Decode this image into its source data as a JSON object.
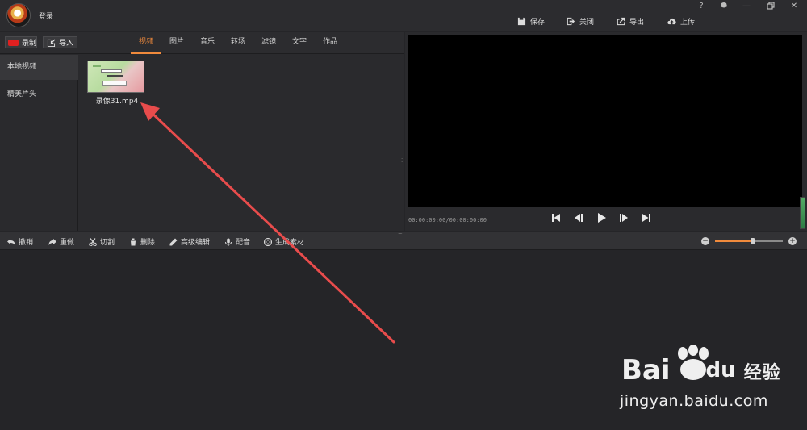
{
  "header": {
    "login_label": "登录",
    "window_controls": {
      "help": "?",
      "skin": "skin-icon",
      "minimize": "—",
      "restore": "restore-icon",
      "close": "✕"
    },
    "actions": {
      "save": "保存",
      "close": "关闭",
      "export": "导出",
      "upload": "上传"
    }
  },
  "media": {
    "record_label": "录制",
    "import_label": "导入",
    "tabs": [
      {
        "label": "视频",
        "active": true
      },
      {
        "label": "图片",
        "active": false
      },
      {
        "label": "音乐",
        "active": false
      },
      {
        "label": "转场",
        "active": false
      },
      {
        "label": "滤镜",
        "active": false
      },
      {
        "label": "文字",
        "active": false
      },
      {
        "label": "作品",
        "active": false
      }
    ],
    "nav": [
      {
        "label": "本地视频",
        "active": true
      },
      {
        "label": "精美片头",
        "active": false
      }
    ],
    "items": [
      {
        "name": "录像31.mp4"
      }
    ]
  },
  "preview": {
    "timecode": "00:00:00:00/00:00:00:00"
  },
  "edit_toolbar": {
    "undo": "撤销",
    "redo": "重做",
    "cut": "切割",
    "delete": "删除",
    "advanced_edit": "高级编辑",
    "dub": "配音",
    "generate_material": "生成素材"
  },
  "zoom": {
    "level_fraction": 0.55
  },
  "colors": {
    "accent": "#f08a3c",
    "record_red": "#e02020",
    "annotation_arrow": "#e84c4c"
  },
  "watermark": {
    "brand": "Bai",
    "brand_suffix": "du",
    "cn_text": "经验",
    "url": "jingyan.baidu.com"
  }
}
